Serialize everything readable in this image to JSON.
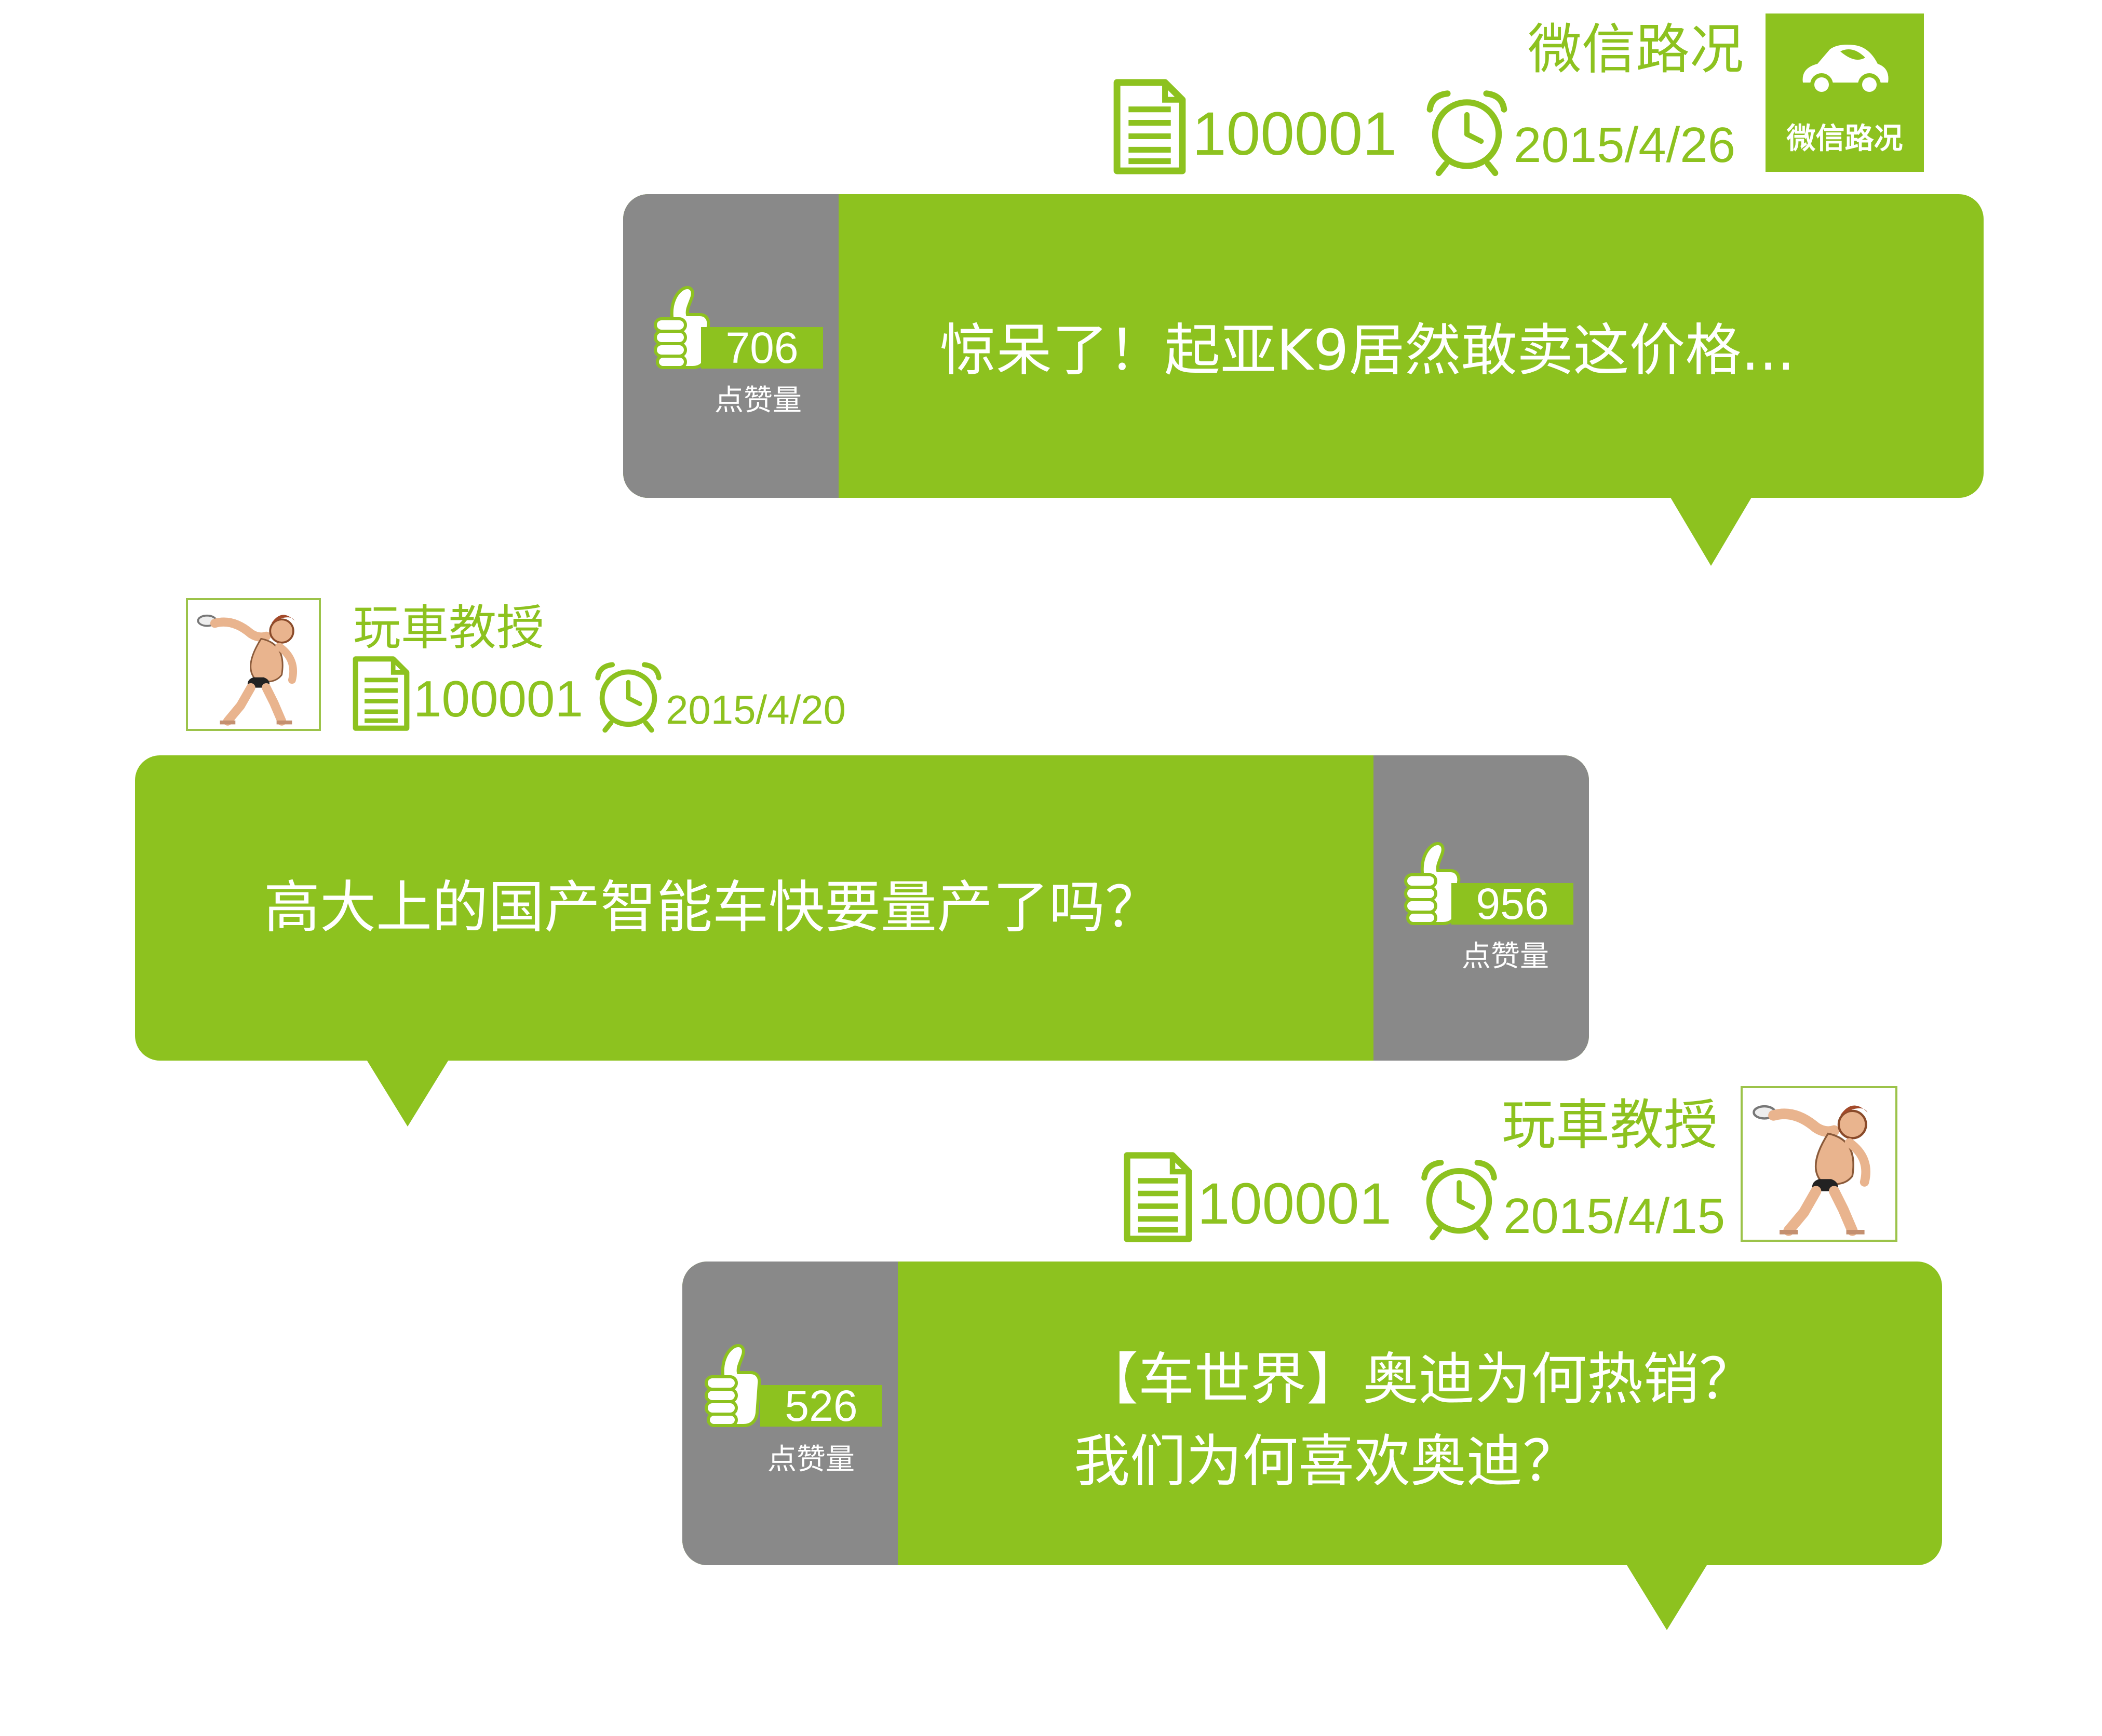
{
  "colors": {
    "accent": "#8dc21f",
    "panel": "#898989",
    "text_on_accent": "#ffffff"
  },
  "posts": [
    {
      "author": "微信路况",
      "post_id": "100001",
      "date": "2015/4/26",
      "title": "惊呆了！起亚K9居然敢卖这价格...",
      "likes": "706",
      "likes_label": "点赞量",
      "avatar_text": "微信路况",
      "avatar_icon": "car-leaf-logo"
    },
    {
      "author": "玩車教授",
      "post_id": "100001",
      "date": "2015/4/20",
      "title": "高大上的国产智能车快要量产了吗？",
      "likes": "956",
      "likes_label": "点赞量",
      "avatar_icon": "discus-thrower-cartoon"
    },
    {
      "author": "玩車教授",
      "post_id": "100001",
      "date": "2015/4/15",
      "title_line1": "【车世界】奥迪为何热销？",
      "title_line2": "我们为何喜欢奥迪？",
      "likes": "526",
      "likes_label": "点赞量",
      "avatar_icon": "discus-thrower-cartoon"
    }
  ]
}
